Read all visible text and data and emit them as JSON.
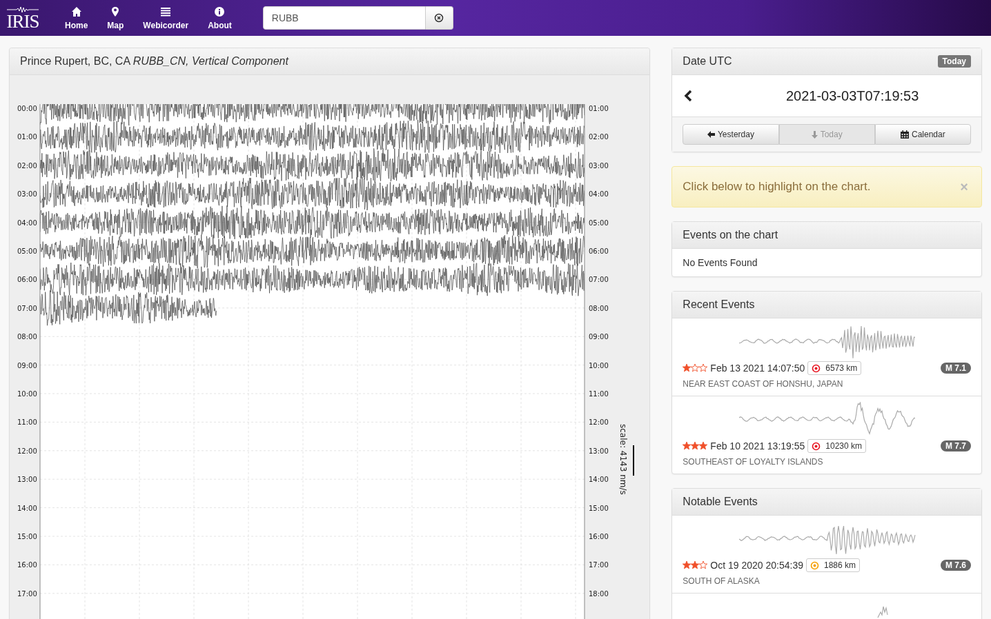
{
  "nav": {
    "logo": "IRIS",
    "items": [
      {
        "label": "Home",
        "kind": "home"
      },
      {
        "label": "Map",
        "kind": "map"
      },
      {
        "label": "Webicorder",
        "kind": "list"
      },
      {
        "label": "About",
        "kind": "info"
      }
    ],
    "search": {
      "value": "RUBB"
    }
  },
  "station_panel": {
    "title": "Prince Rupert, BC, CA *RUBB_CN, Vertical Component*",
    "left_labels": [
      "00:00",
      "01:00",
      "02:00",
      "03:00",
      "04:00",
      "05:00",
      "06:00",
      "07:00",
      "08:00",
      "09:00",
      "10:00",
      "11:00",
      "12:00",
      "13:00",
      "14:00",
      "15:00",
      "16:00",
      "17:00"
    ],
    "right_labels": [
      "01:00",
      "02:00",
      "03:00",
      "04:00",
      "05:00",
      "06:00",
      "07:00",
      "08:00",
      "09:00",
      "10:00",
      "11:00",
      "12:00",
      "13:00",
      "14:00",
      "15:00",
      "16:00",
      "17:00",
      "18:00"
    ],
    "scale": "scale: 4143 nm/s"
  },
  "date_panel": {
    "title": "Date UTC",
    "badge": "Today",
    "datetime": "2021-03-03T07:19:53",
    "buttons": [
      {
        "label": "Yesterday",
        "kind": "back",
        "disabled": false
      },
      {
        "label": "Today",
        "kind": "down",
        "disabled": true
      },
      {
        "label": "Calendar",
        "kind": "calendar",
        "disabled": false
      }
    ]
  },
  "alert": {
    "text": "Click below to highlight on the chart.",
    "close": "×"
  },
  "events_on_chart": {
    "title": "Events on the chart",
    "empty": "No Events Found"
  },
  "recent_events": {
    "title": "Recent Events",
    "items": [
      {
        "stars": 1,
        "time": "Feb 13 2021 14:07:50",
        "distance": "6573 km",
        "color": "#e8121f",
        "magnitude": "M 7.1",
        "region": "NEAR EAST COAST OF HONSHU, JAPAN"
      },
      {
        "stars": 3,
        "time": "Feb 10 2021 13:19:55",
        "distance": "10230 km",
        "color": "#e8121f",
        "magnitude": "M 7.7",
        "region": "SOUTHEAST OF LOYALTY ISLANDS"
      }
    ]
  },
  "notable_events": {
    "title": "Notable Events",
    "items": [
      {
        "stars": 2,
        "time": "Oct 19 2020 20:54:39",
        "distance": "1886 km",
        "color": "#f5a000",
        "magnitude": "M 7.6",
        "region": "SOUTH OF ALASKA"
      }
    ]
  }
}
